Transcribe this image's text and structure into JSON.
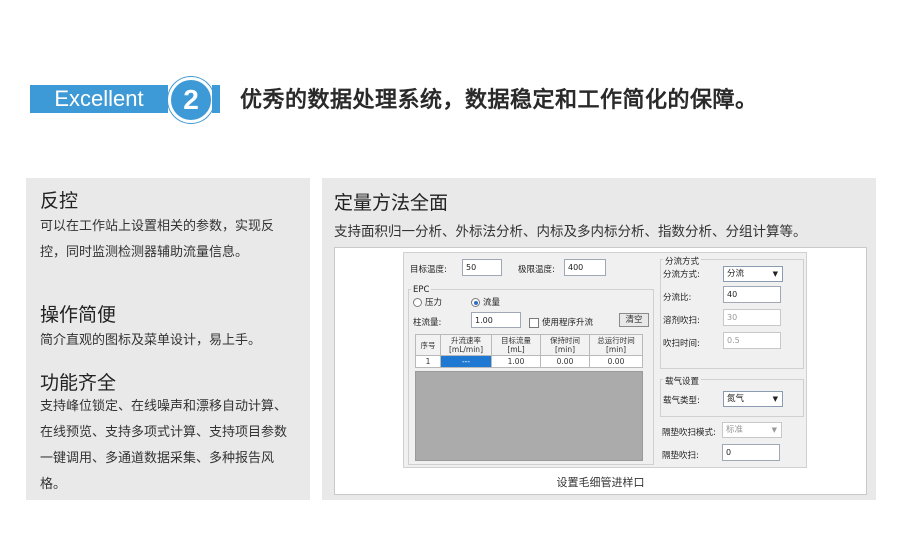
{
  "header": {
    "badge_text": "Excellent",
    "badge_number": "2",
    "headline": "优秀的数据处理系统，数据稳定和工作简化的保障。",
    "accent_color": "#3d9ad6"
  },
  "left": {
    "sections": [
      {
        "title": "反控",
        "text": "可以在工作站上设置相关的参数，实现反控，同时监测检测器辅助流量信息。"
      },
      {
        "title": "操作简便",
        "text": "简介直观的图标及菜单设计，易上手。"
      },
      {
        "title": "功能齐全",
        "text": "支持峰位锁定、在线噪声和漂移自动计算、在线预览、支持多项式计算、支持项目参数一键调用、多通道数据采集、多种报告风格。"
      }
    ]
  },
  "right": {
    "title": "定量方法全面",
    "subtitle": "支持面积归一分析、外标法分析、内标及多内标分析、指数分析、分组计算等。",
    "caption": "设置毛细管进样口",
    "form": {
      "target_temp_label": "目标温度:",
      "target_temp_value": "50",
      "limit_temp_label": "极限温度:",
      "limit_temp_value": "400",
      "epc_label": "EPC",
      "pressure_label": "压力",
      "flow_label": "流量",
      "column_flow_label": "柱流量:",
      "column_flow_value": "1.00",
      "use_program_label": "使用程序升流",
      "clear_button": "清空",
      "table_headers": [
        "序号",
        "升流速率\n[mL/min]",
        "目标流量\n[mL]",
        "保持时间\n[min]",
        "总运行时间\n[min]"
      ],
      "table_row": [
        "1",
        "---",
        "1.00",
        "0.00",
        "0.00"
      ],
      "split_group_label": "分流方式",
      "split_mode_label": "分流方式:",
      "split_mode_value": "分流",
      "split_ratio_label": "分流比:",
      "split_ratio_value": "40",
      "purge_label": "溶剂吹扫:",
      "purge_value": "30",
      "purge_time_label": "吹扫时间:",
      "purge_time_value": "0.5",
      "carrier_group_label": "载气设置",
      "carrier_type_label": "载气类型:",
      "carrier_type_value": "氮气",
      "septum_mode_label": "隔垫吹扫模式:",
      "septum_mode_value": "标准",
      "septum_purge_label": "隔垫吹扫:",
      "septum_purge_value": "0"
    }
  }
}
